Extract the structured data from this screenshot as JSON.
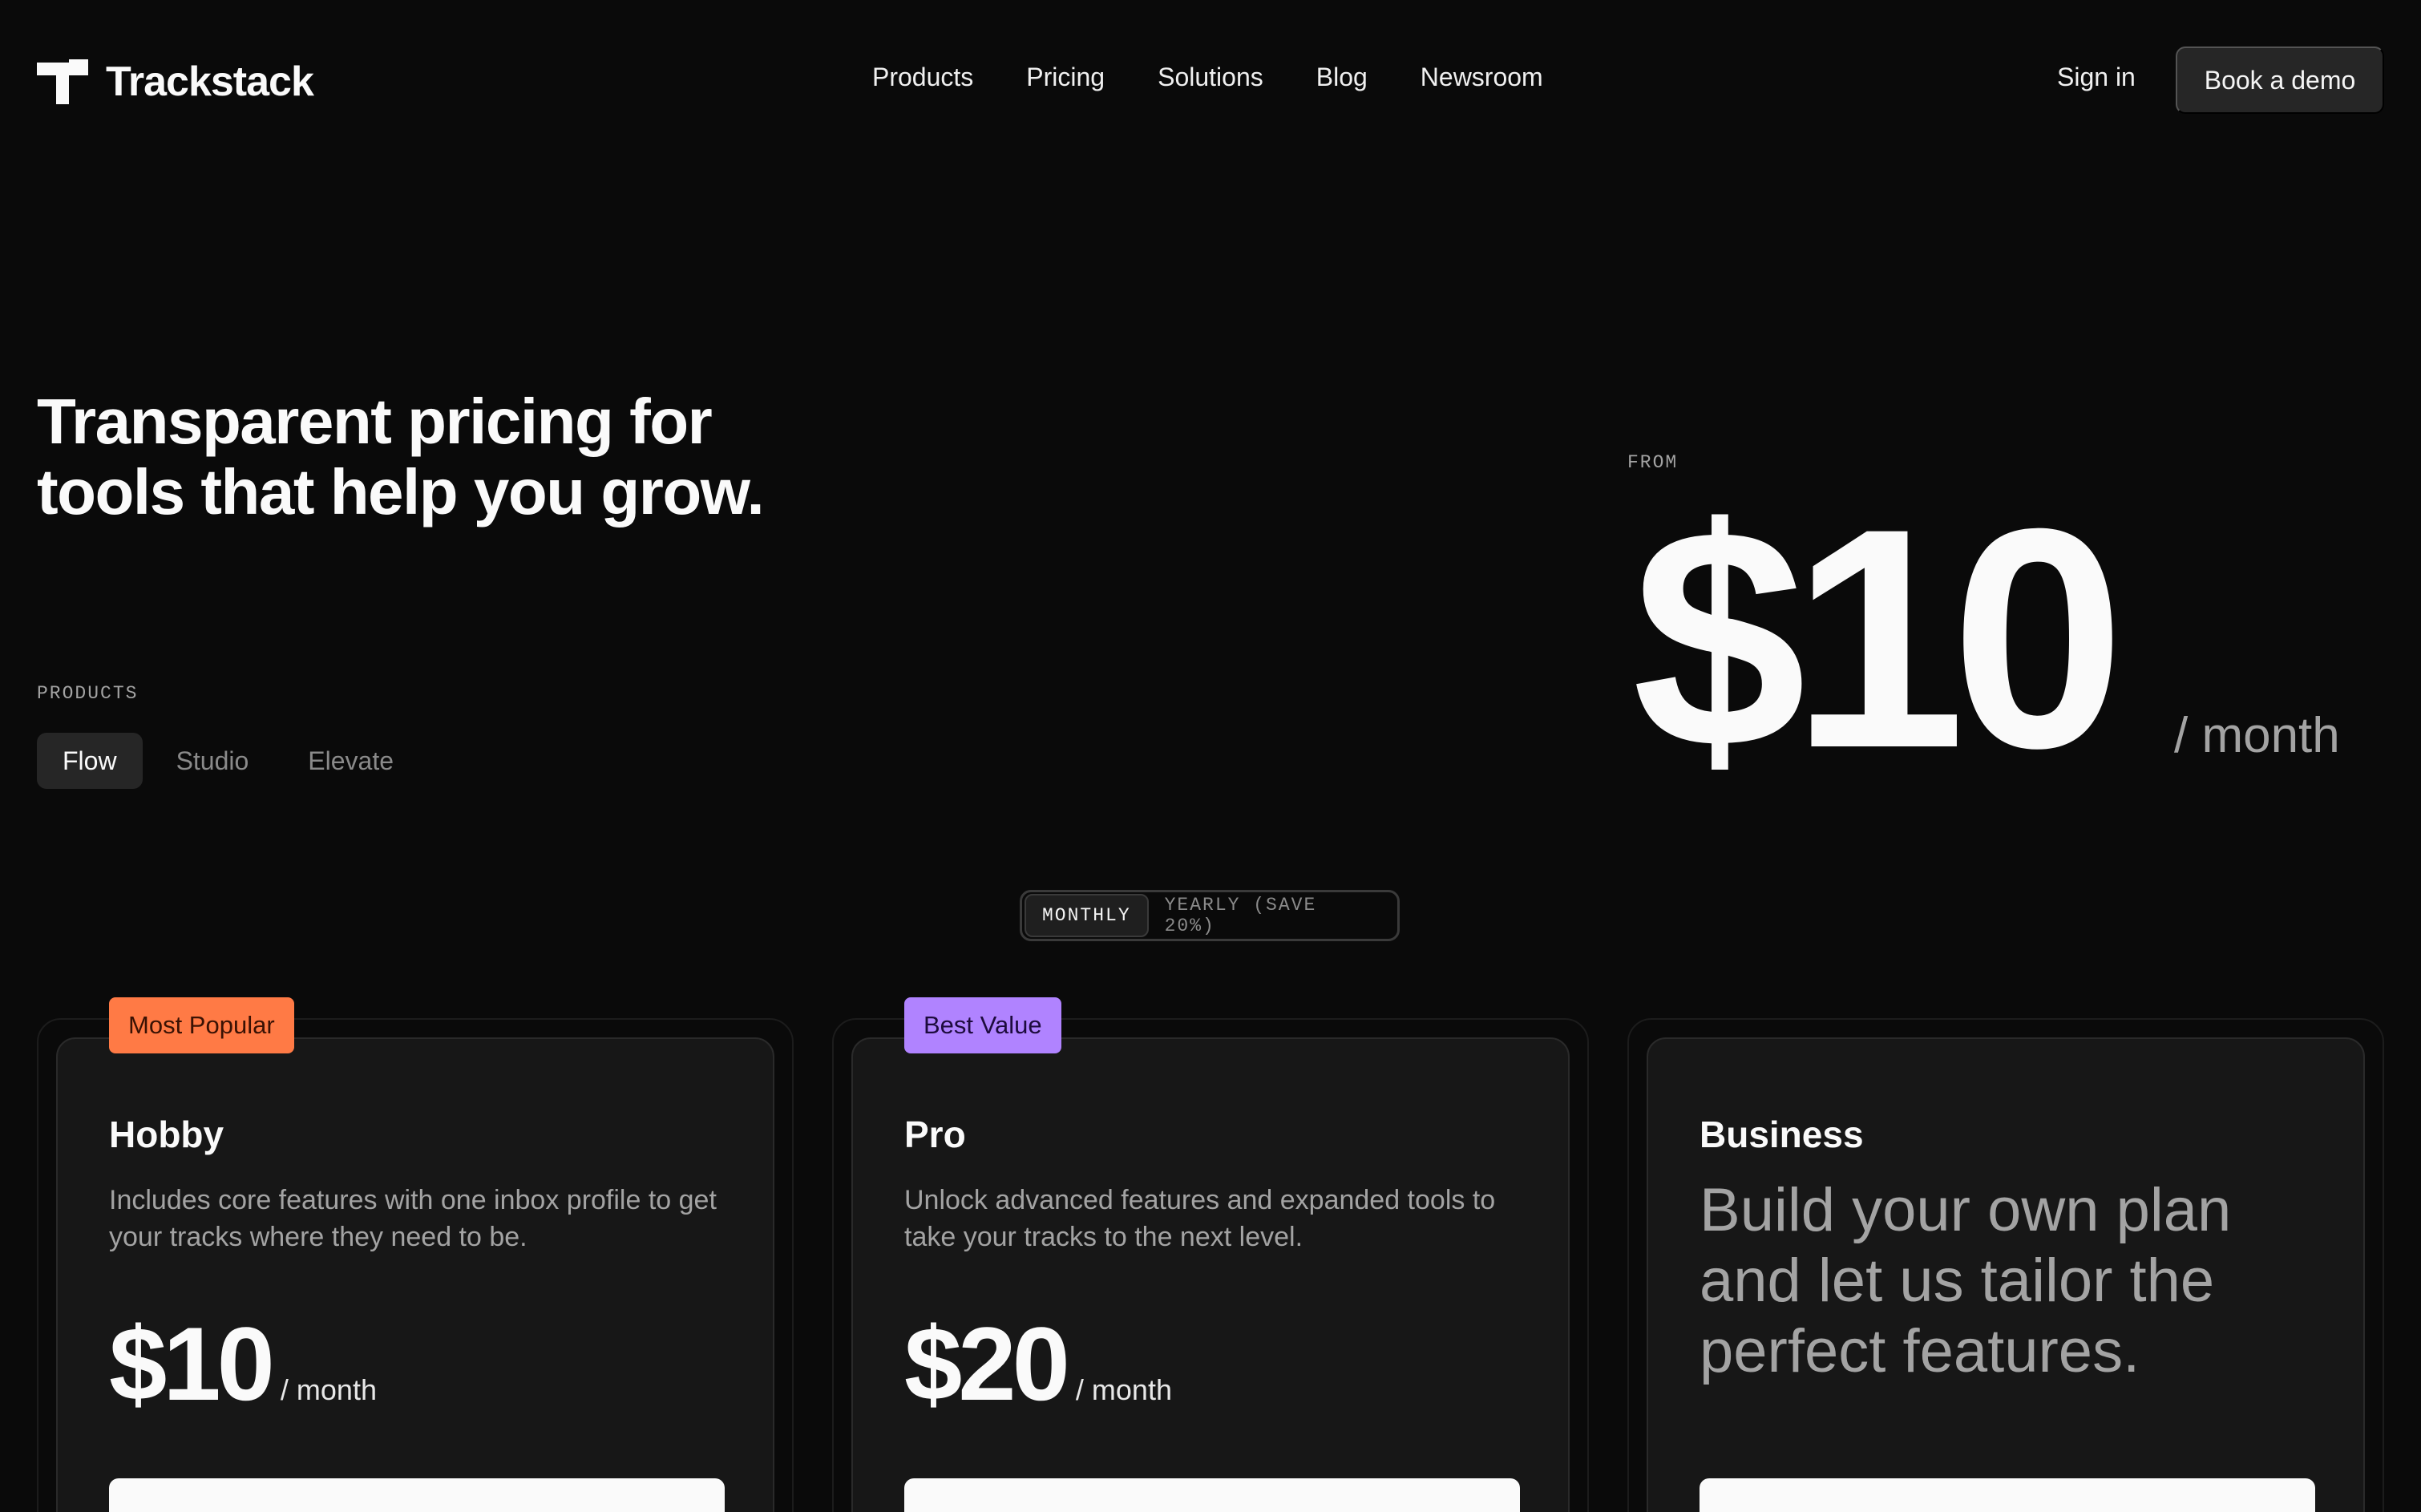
{
  "brand": {
    "name": "Trackstack",
    "icon": "trackstack-logo-icon"
  },
  "nav": {
    "links": [
      "Products",
      "Pricing",
      "Solutions",
      "Blog",
      "Newsroom"
    ],
    "sign_in": "Sign in",
    "book_demo": "Book a demo"
  },
  "hero": {
    "title_line1": "Transparent pricing for",
    "title_line2": "tools that help you grow.",
    "products_label": "PRODUCTS",
    "product_tabs": [
      "Flow",
      "Studio",
      "Elevate"
    ],
    "active_product": "Flow",
    "from_label": "FROM",
    "from_price": "$10",
    "from_unit": "/ month"
  },
  "billing": {
    "monthly": "MONTHLY",
    "yearly": "YEARLY (SAVE 20%)",
    "selected": "MONTHLY"
  },
  "plans": [
    {
      "badge": "Most Popular",
      "badge_color": "#ff7a45",
      "name": "Hobby",
      "description": "Includes core features with one inbox profile to get your tracks where they need to be.",
      "price": "$10",
      "unit": "/ month"
    },
    {
      "badge": "Best Value",
      "badge_color": "#b083ff",
      "name": "Pro",
      "description": "Unlock advanced features and expanded tools to take your tracks to the next level.",
      "price": "$20",
      "unit": "/ month"
    },
    {
      "name": "Business",
      "headline": "Build your own plan and let us tailor the perfect features."
    }
  ],
  "colors": {
    "background": "#0a0a0a",
    "card": "#171717",
    "accent_orange": "#ff7a45",
    "accent_purple": "#b083ff"
  }
}
